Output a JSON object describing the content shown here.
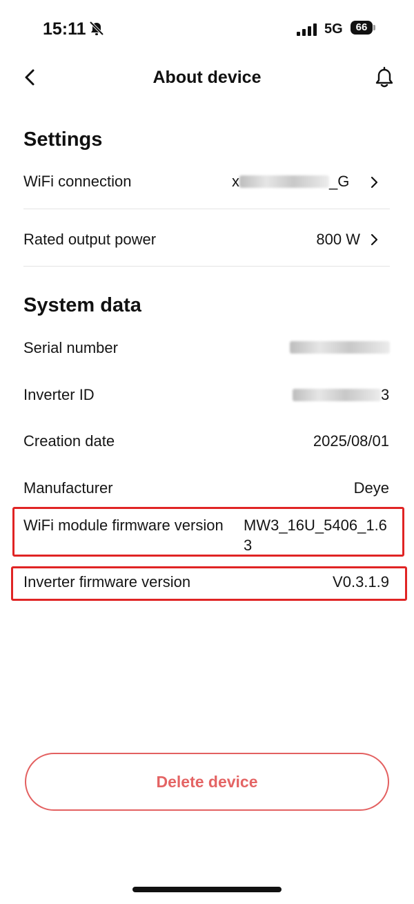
{
  "status_bar": {
    "time": "15:11",
    "network": "5G",
    "battery": "66",
    "icons": [
      "bell-slash-icon",
      "signal-bars-icon",
      "battery-icon"
    ]
  },
  "header": {
    "title": "About device",
    "icons": [
      "chevron-left-icon",
      "bell-icon"
    ]
  },
  "settings": {
    "title": "Settings",
    "wifi_label": "WiFi connection",
    "wifi_value_visible_prefix": "x",
    "wifi_value_visible_suffix": "_G",
    "rated_label": "Rated output power",
    "rated_value": "800 W"
  },
  "system_data": {
    "title": "System data",
    "serial_label": "Serial number",
    "inverter_id_label": "Inverter ID",
    "inverter_id_visible_suffix": "3",
    "creation_label": "Creation date",
    "creation_value": "2025/08/01",
    "manufacturer_label": "Manufacturer",
    "manufacturer_value": "Deye",
    "wifi_fw_label": "WiFi module firmware version",
    "wifi_fw_value": "MW3_16U_5406_1.63",
    "inverter_fw_label": "Inverter firmware version",
    "inverter_fw_value": "V0.3.1.9"
  },
  "actions": {
    "delete_label": "Delete device"
  },
  "colors": {
    "highlight": "#e02424",
    "delete": "#e46464"
  }
}
